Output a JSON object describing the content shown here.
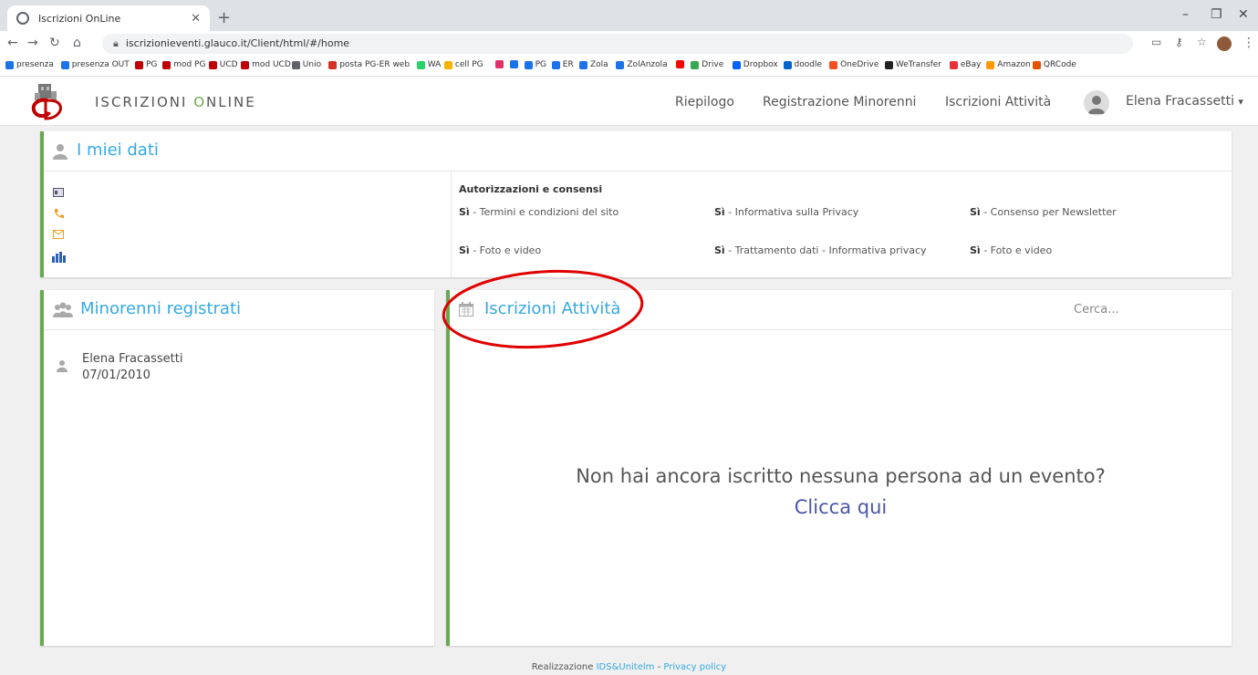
{
  "browser": {
    "tab_title": "Iscrizioni OnLine",
    "url": "iscrizionieventi.glauco.it/Client/html/#/home",
    "bookmarks": [
      {
        "label": "presenza",
        "color": "#1a73e8"
      },
      {
        "label": "presenza OUT",
        "color": "#1a73e8"
      },
      {
        "label": "PG",
        "color": "#c00000"
      },
      {
        "label": "mod PG",
        "color": "#c00000"
      },
      {
        "label": "UCD",
        "color": "#c00000"
      },
      {
        "label": "mod UCD",
        "color": "#c00000"
      },
      {
        "label": "Unio",
        "color": "#5f6368"
      },
      {
        "label": "posta PG-ER web",
        "color": "#d93025"
      },
      {
        "label": "WA",
        "color": "#25d366"
      },
      {
        "label": "cell PG",
        "color": "#f4b400"
      },
      {
        "label": "",
        "color": "#e1306c"
      },
      {
        "label": "",
        "color": "#1a73e8"
      },
      {
        "label": "PG",
        "color": "#1a73e8"
      },
      {
        "label": "ER",
        "color": "#1a73e8"
      },
      {
        "label": "Zola",
        "color": "#1a73e8"
      },
      {
        "label": "ZolAnzola",
        "color": "#1a73e8"
      },
      {
        "label": "",
        "color": "#ff0000"
      },
      {
        "label": "Drive",
        "color": "#34a853"
      },
      {
        "label": "Dropbox",
        "color": "#0061ff"
      },
      {
        "label": "doodle",
        "color": "#0066cc"
      },
      {
        "label": "OneDrive",
        "color": "#f25022"
      },
      {
        "label": "WeTransfer",
        "color": "#222222"
      },
      {
        "label": "eBay",
        "color": "#e53238"
      },
      {
        "label": "Amazon",
        "color": "#ff9900"
      },
      {
        "label": "QRCode",
        "color": "#e65100"
      }
    ]
  },
  "header": {
    "brand_a": "ISCRIZIONI ",
    "brand_b": "O",
    "brand_c": "NLINE",
    "nav": [
      "Riepilogo",
      "Registrazione Minorenni",
      "Iscrizioni Attività"
    ],
    "user_name": "Elena Fracassetti",
    "user_caret": "▾"
  },
  "dati": {
    "title": "I miei dati",
    "auth_title": "Autorizzazioni e consensi",
    "consents": [
      {
        "value": "Sì",
        "label": " - Termini e condizioni del sito"
      },
      {
        "value": "Sì",
        "label": " - Informativa sulla Privacy"
      },
      {
        "value": "Sì",
        "label": " - Consenso per Newsletter"
      },
      {
        "value": "Sì",
        "label": " - Foto e video"
      },
      {
        "value": "Sì",
        "label": " - Trattamento dati - Informativa privacy"
      },
      {
        "value": "Sì",
        "label": " - Foto e video"
      }
    ]
  },
  "minorenni": {
    "title": "Minorenni registrati",
    "items": [
      {
        "name": "Elena Fracassetti",
        "date": "07/01/2010"
      }
    ]
  },
  "attivita": {
    "title": "Iscrizioni Attività",
    "search_placeholder": "Cerca...",
    "empty_message": "Non hai ancora iscritto nessuna persona ad un evento?",
    "cta": "Clicca qui"
  },
  "footer": {
    "prefix": "Realizzazione ",
    "company": "IDS&Unitelm",
    "sep": " - ",
    "privacy": "Privacy policy"
  },
  "colors": {
    "accent": "#36a9e1",
    "panel_border": "#6aa84f",
    "annotation": "#e00000",
    "link": "#4a56a8"
  }
}
